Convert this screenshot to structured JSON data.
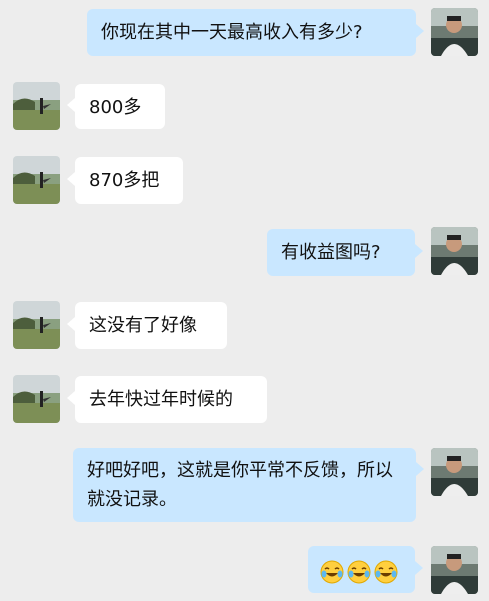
{
  "messages": [
    {
      "side": "me",
      "text": "你现在其中一天最高收入有多少?"
    },
    {
      "side": "other",
      "text": "800多"
    },
    {
      "side": "other",
      "text": "870多把"
    },
    {
      "side": "me",
      "text": "有收益图吗?"
    },
    {
      "side": "other",
      "text": "这没有了好像"
    },
    {
      "side": "other",
      "text": "去年快过年时候的"
    },
    {
      "side": "me",
      "text": "好吧好吧，这就是你平常不反馈，所以就没记录。"
    },
    {
      "side": "me",
      "emoji": [
        "laughing-crying-emoji",
        "laughing-crying-emoji",
        "laughing-crying-emoji"
      ]
    }
  ],
  "colors": {
    "background": "#ededed",
    "my_bubble": "#c9e7ff",
    "other_bubble": "#ffffff"
  }
}
